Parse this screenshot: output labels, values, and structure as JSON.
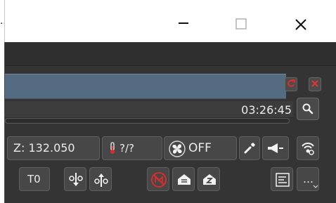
{
  "window": {
    "title": "…",
    "controls": [
      "minimize",
      "maximize",
      "close"
    ]
  },
  "toolbar_row1": {
    "z_label": "Z: 132.050",
    "temp_label": "?/?",
    "fan_label": "OFF"
  },
  "status": {
    "time": "03:26:45"
  },
  "toolbar_row2": {
    "t0_label": "T0",
    "more_label": "…"
  },
  "icons": {
    "refresh": "refresh-icon",
    "close": "close-icon",
    "search": "search-icon",
    "thermometer": "thermometer-icon",
    "fan": "fan-icon",
    "wrench": "wrench-icon",
    "horn": "horn-icon",
    "wifi": "wifi-gear-icon",
    "extrude_down": "extrude-down-icon",
    "extrude_up": "extrude-up-icon",
    "motor_off": "motor-off-icon",
    "home": "home-icon",
    "zero": "z-home-icon",
    "terminal": "terminal-icon"
  },
  "colors": {
    "accent": "#d72d2d",
    "panel": "#556b81",
    "background": "#343434"
  }
}
